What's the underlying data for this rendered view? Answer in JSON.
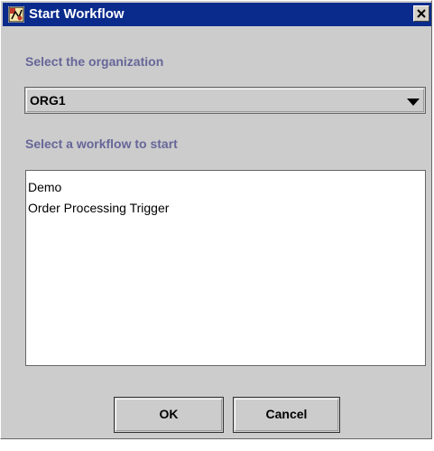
{
  "window": {
    "title": "Start Workflow",
    "app_icon": "workflow-app-icon",
    "close_icon": "close-icon"
  },
  "organization": {
    "label": "Select the organization",
    "selected": "ORG1",
    "dropdown_icon": "triangle-down-icon"
  },
  "workflows": {
    "label": "Select a workflow to start",
    "items": [
      "Demo",
      "Order Processing Trigger"
    ]
  },
  "buttons": {
    "ok": "OK",
    "cancel": "Cancel"
  },
  "colors": {
    "titlebar": "#0a2b8c",
    "section_label": "#666699",
    "window_bg": "#cccccc"
  }
}
